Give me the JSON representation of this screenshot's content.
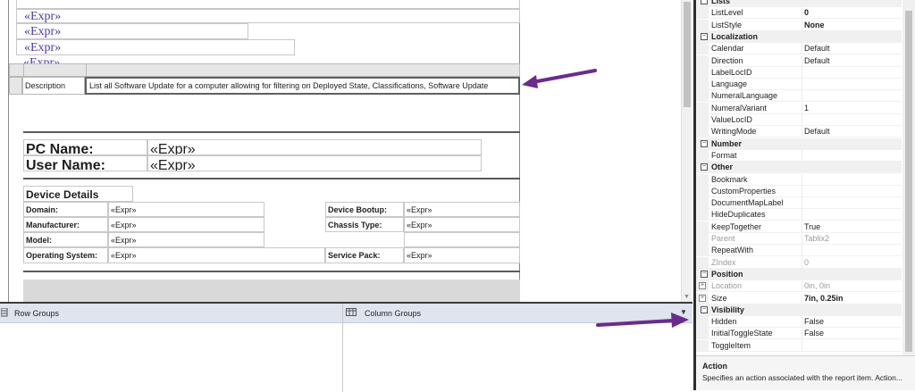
{
  "designer": {
    "top_exprs": [
      "«Expr»",
      "«Expr»",
      "«Expr»",
      "«Expr»"
    ],
    "description_label": "Description",
    "description_text": "List all Software Update for a computer allowing for filtering on Deployed State, Classifications, Software Update",
    "pc_name_label": "PC Name:",
    "pc_name_expr": "«Expr»",
    "user_name_label": "User Name:",
    "user_name_expr": "«Expr»",
    "device_details_title": "Device Details",
    "details_rows": [
      {
        "label": "Domain:",
        "expr": "«Expr»",
        "right_label": "Device Bootup:",
        "right_expr": "«Expr»"
      },
      {
        "label": "Manufacturer:",
        "expr": "«Expr»",
        "right_label": "Chassis Type:",
        "right_expr": "«Expr»"
      },
      {
        "label": "Model:",
        "expr": "«Expr»",
        "right_label": "",
        "right_expr": ""
      },
      {
        "label": "Operating System:",
        "expr": "«Expr»",
        "right_label": "Service Pack:",
        "right_expr": "«Expr»"
      }
    ]
  },
  "groups": {
    "row_groups_label": "Row Groups",
    "column_groups_label": "Column Groups"
  },
  "properties": {
    "categories": [
      {
        "name": "Lists",
        "rows": [
          {
            "name": "ListLevel",
            "value": "0",
            "bold": true
          },
          {
            "name": "ListStyle",
            "value": "None",
            "bold": true
          }
        ]
      },
      {
        "name": "Localization",
        "rows": [
          {
            "name": "Calendar",
            "value": "Default"
          },
          {
            "name": "Direction",
            "value": "Default"
          },
          {
            "name": "LabelLocID",
            "value": ""
          },
          {
            "name": "Language",
            "value": ""
          },
          {
            "name": "NumeralLanguage",
            "value": ""
          },
          {
            "name": "NumeralVariant",
            "value": "1"
          },
          {
            "name": "ValueLocID",
            "value": ""
          },
          {
            "name": "WritingMode",
            "value": "Default"
          }
        ]
      },
      {
        "name": "Number",
        "rows": [
          {
            "name": "Format",
            "value": ""
          }
        ]
      },
      {
        "name": "Other",
        "rows": [
          {
            "name": "Bookmark",
            "value": ""
          },
          {
            "name": "CustomProperties",
            "value": ""
          },
          {
            "name": "DocumentMapLabel",
            "value": ""
          },
          {
            "name": "HideDuplicates",
            "value": ""
          },
          {
            "name": "KeepTogether",
            "value": "True"
          },
          {
            "name": "Parent",
            "value": "Tablix2",
            "dim": true
          },
          {
            "name": "RepeatWith",
            "value": ""
          },
          {
            "name": "ZIndex",
            "value": "0",
            "dim": true
          }
        ]
      },
      {
        "name": "Position",
        "rows": [
          {
            "name": "Location",
            "value": "0in, 0in",
            "dim": true,
            "expandable": true
          },
          {
            "name": "Size",
            "value": "7in, 0.25in",
            "bold": true,
            "expandable": true
          }
        ]
      },
      {
        "name": "Visibility",
        "rows": [
          {
            "name": "Hidden",
            "value": "False"
          },
          {
            "name": "InitialToggleState",
            "value": "False"
          },
          {
            "name": "ToggleItem",
            "value": ""
          }
        ]
      }
    ],
    "help_title": "Action",
    "help_text": "Specifies an action associated with the report item. Action..."
  },
  "colors": {
    "arrow": "#6a2c8c",
    "expr_serif": "#4b3aa0"
  }
}
